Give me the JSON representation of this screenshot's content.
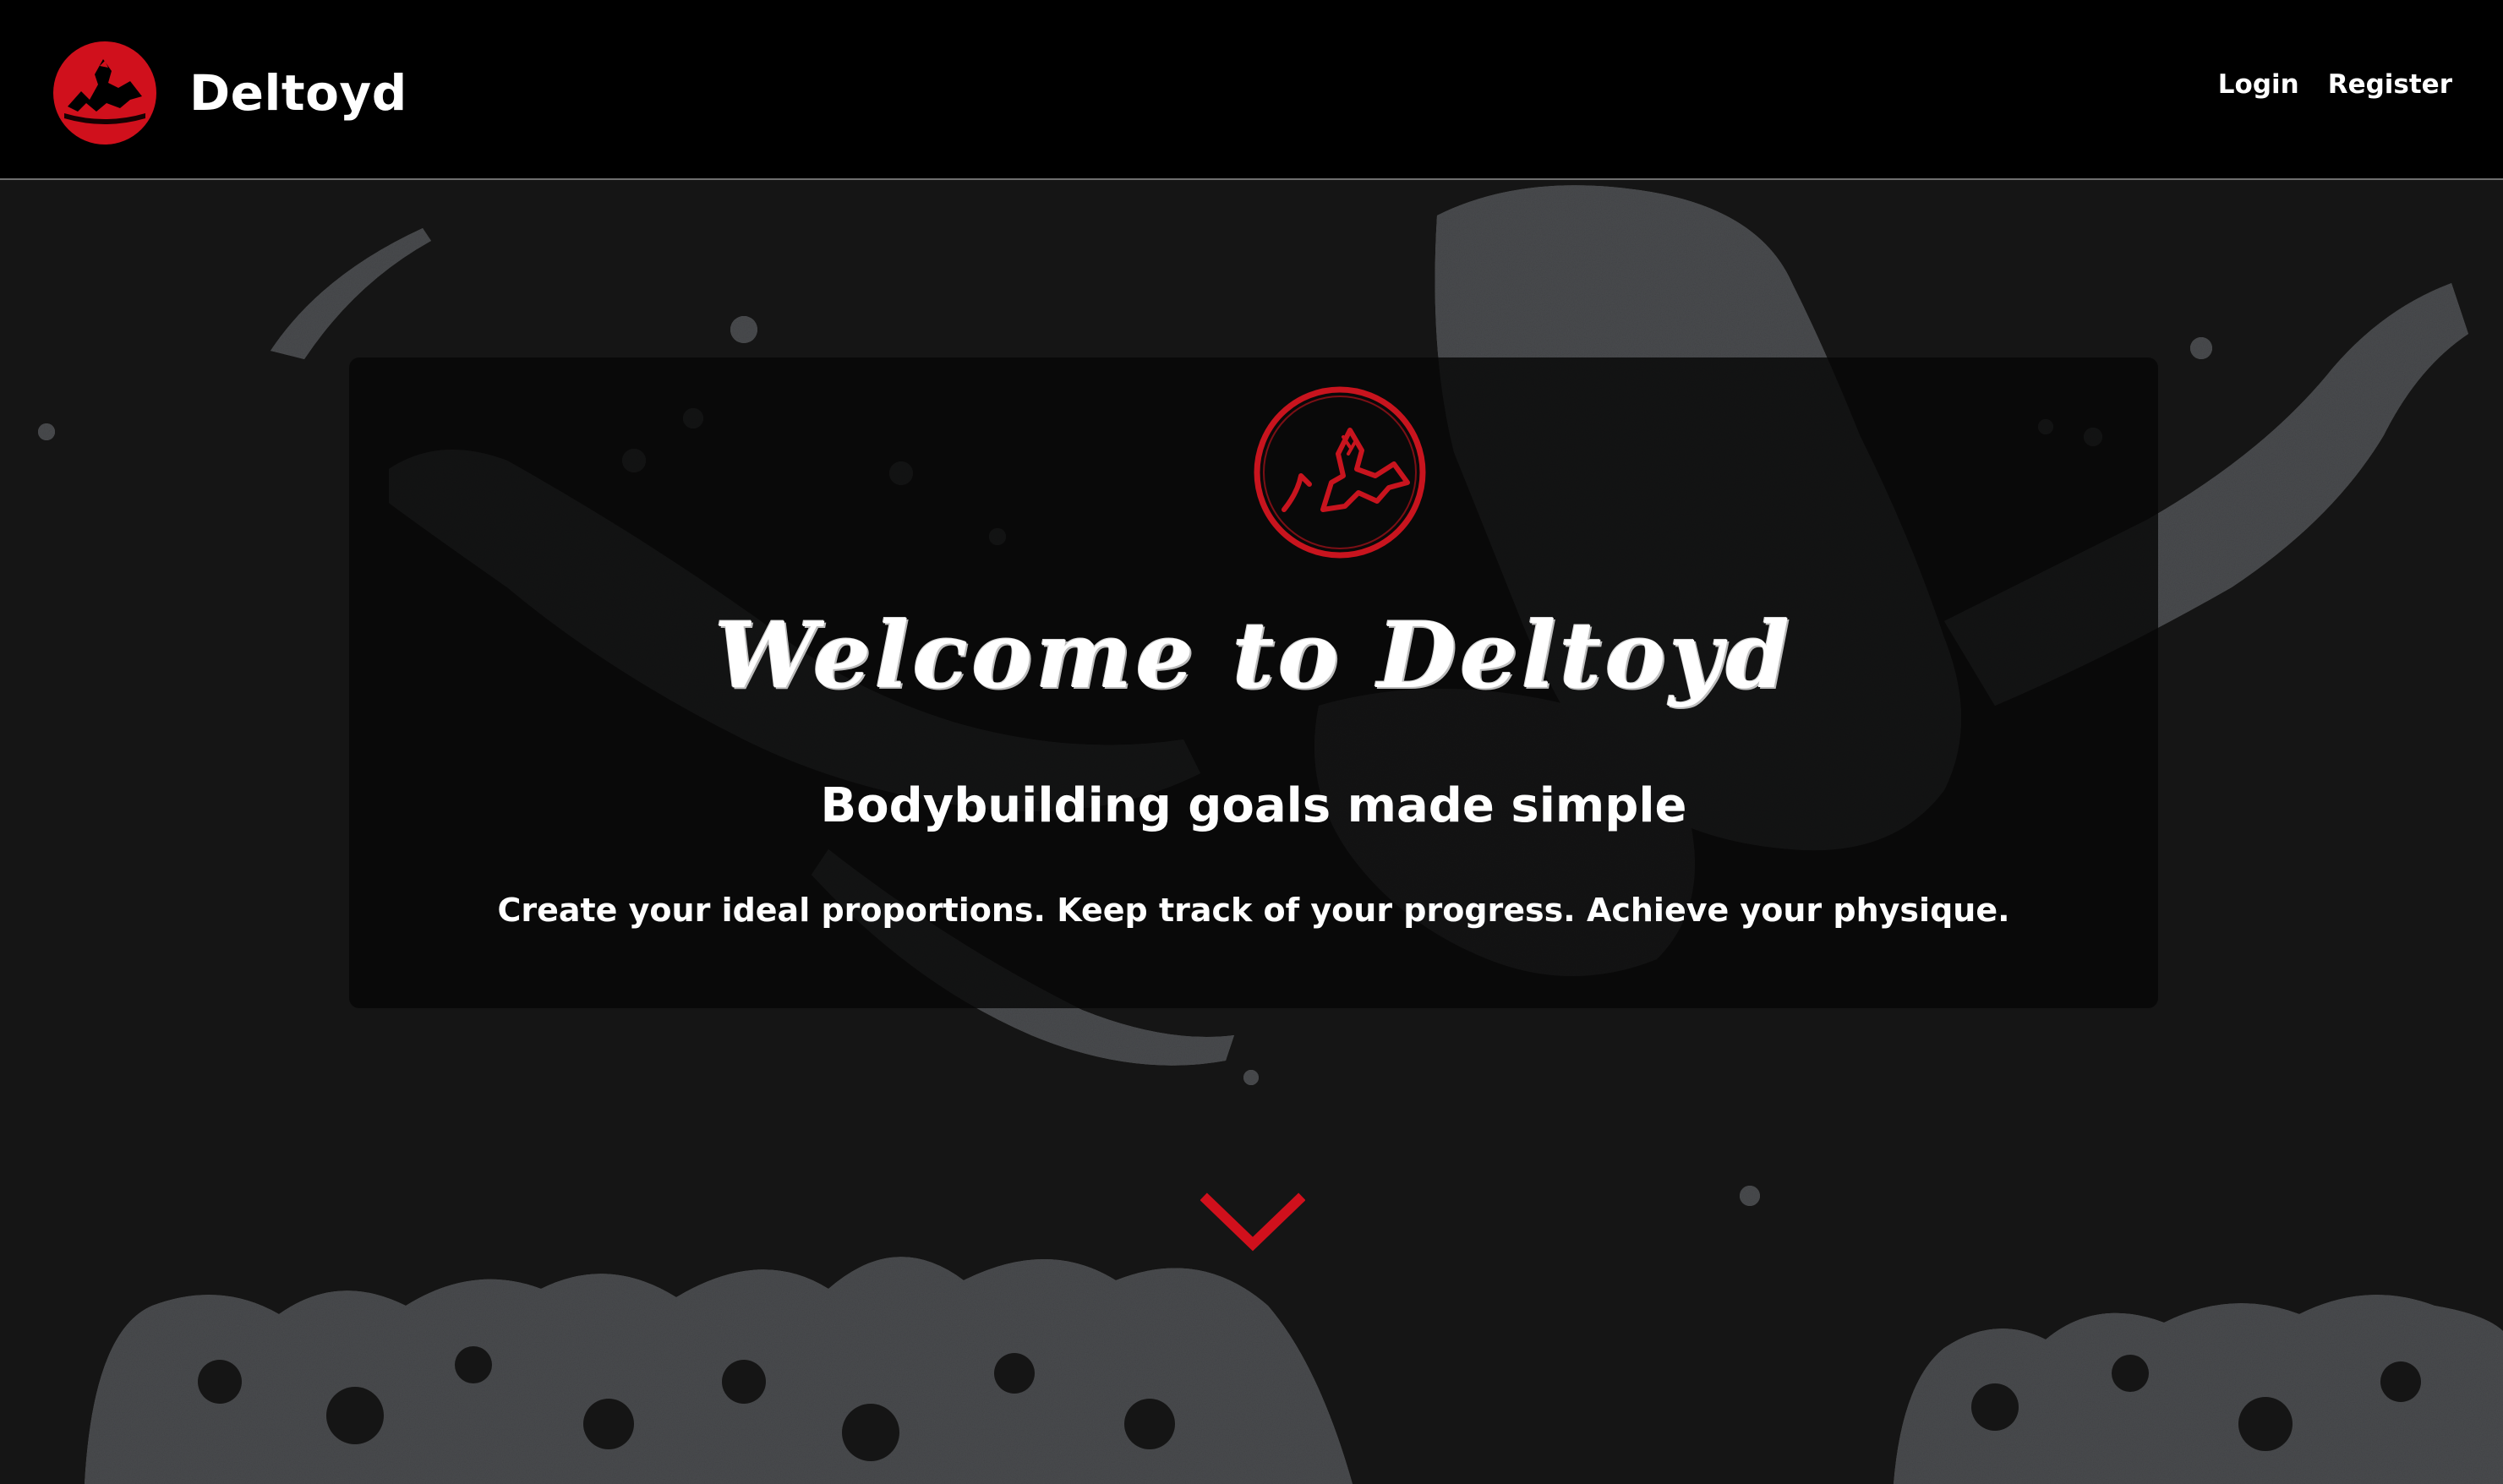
{
  "theme": {
    "accent": "#d0101c",
    "background": "#151515",
    "navbar": "#000000"
  },
  "navbar": {
    "brand_name": "Deltoyd",
    "brand_icon": "deltoyd-logo-icon",
    "links": [
      {
        "label": "Login"
      },
      {
        "label": "Register"
      }
    ]
  },
  "hero": {
    "emblem_icon": "deltoyd-emblem-icon",
    "title": "Welcome to Deltoyd",
    "subtitle": "Bodybuilding goals made simple",
    "tagline": "Create your ideal proportions. Keep track of your progress. Achieve your physique.",
    "scroll_icon": "chevron-down-icon"
  }
}
